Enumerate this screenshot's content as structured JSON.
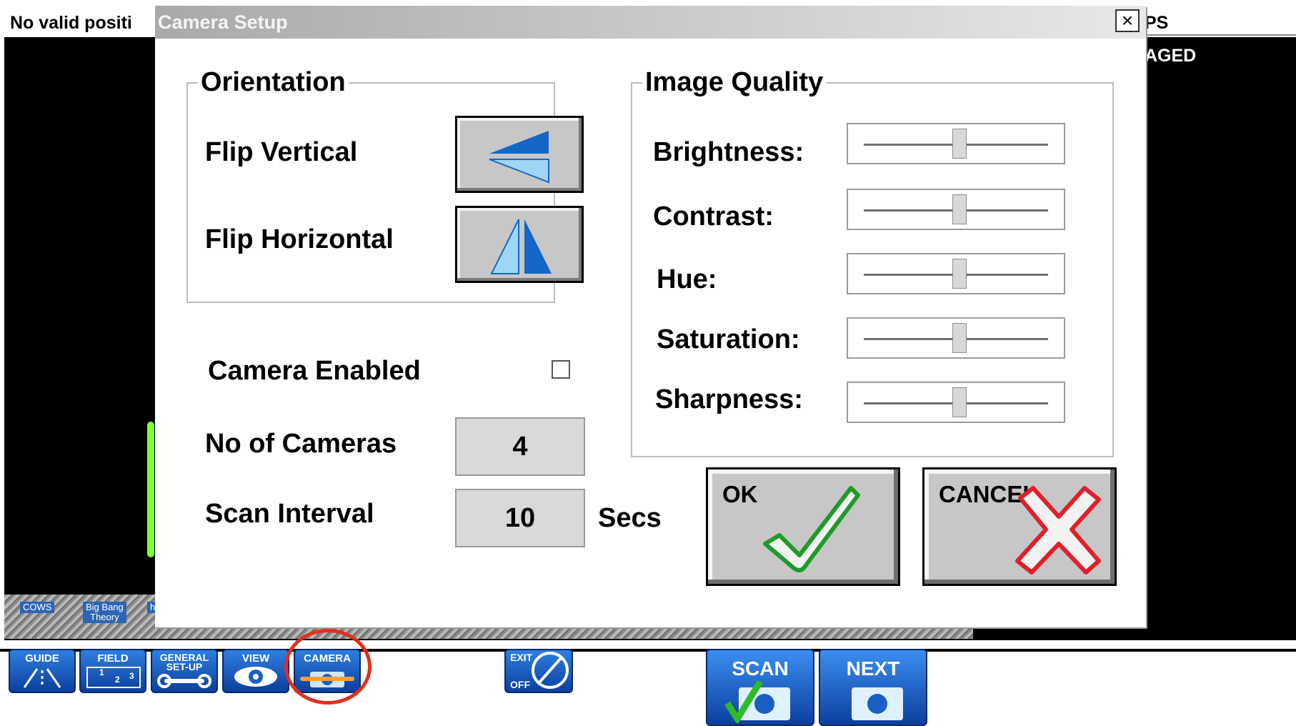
{
  "background": {
    "top_left_status": "No valid positi",
    "top_right_status": "PS",
    "engaged_label": "AGED",
    "map_labels": [
      "COWS",
      "Big Bang\nTheory",
      "h"
    ]
  },
  "toolbar": {
    "guide": "GUIDE",
    "field": "FIELD",
    "field_digits": [
      "1",
      "2",
      "3"
    ],
    "general_setup": "GENERAL\nSET-UP",
    "view": "VIEW",
    "camera": "CAMERA",
    "exit": "EXIT",
    "exit_off": "OFF",
    "scan": "SCAN",
    "next": "NEXT"
  },
  "dialog": {
    "title": "Camera Setup",
    "close_glyph": "×",
    "orientation": {
      "legend": "Orientation",
      "flip_vertical_label": "Flip Vertical",
      "flip_horizontal_label": "Flip Horizontal"
    },
    "camera_enabled": {
      "label": "Camera Enabled",
      "checked": false
    },
    "no_of_cameras": {
      "label": "No of Cameras",
      "value": "4"
    },
    "scan_interval": {
      "label": "Scan Interval",
      "value": "10",
      "unit": "Secs"
    },
    "image_quality": {
      "legend": "Image Quality",
      "sliders": [
        {
          "label": "Brightness:",
          "level": 0.52
        },
        {
          "label": "Contrast:",
          "level": 0.52
        },
        {
          "label": "Hue:",
          "level": 0.52
        },
        {
          "label": "Saturation:",
          "level": 0.52
        },
        {
          "label": "Sharpness:",
          "level": 0.52
        }
      ]
    },
    "ok_label": "OK",
    "cancel_label": "CANCEL"
  },
  "colors": {
    "flip_dark": "#1467c4",
    "flip_light": "#9fd6f5",
    "ok_check": "#1f9a2a",
    "cancel_x": "#e0202a",
    "highlight_circle": "#e0301e"
  },
  "icons": {
    "close": "close-icon",
    "flip_vertical": "flip-vertical-icon",
    "flip_horizontal": "flip-horizontal-icon",
    "ok": "checkmark-icon",
    "cancel": "x-cross-icon"
  }
}
